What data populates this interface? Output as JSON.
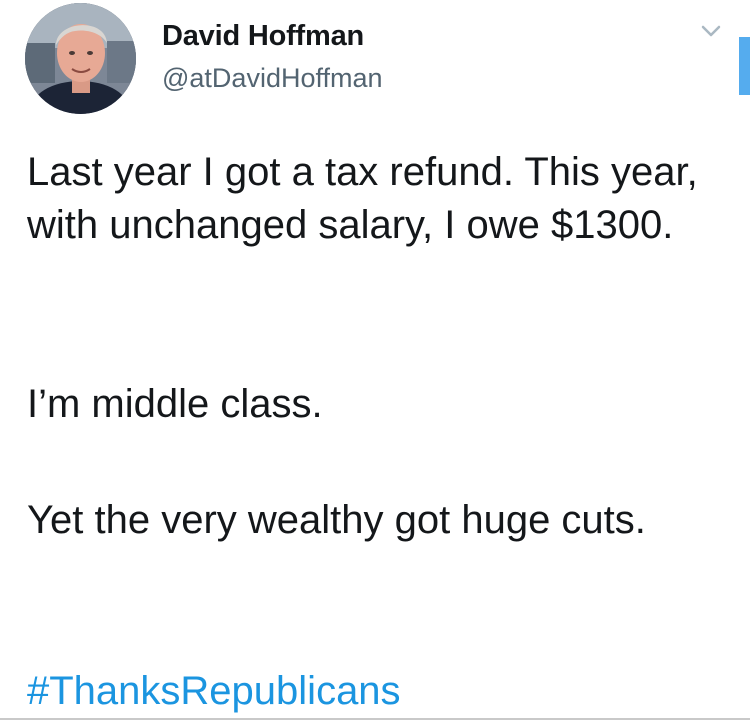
{
  "author": {
    "name": "David Hoffman",
    "handle": "@atDavidHoffman"
  },
  "tweet": {
    "paragraph_1": "Last year I got a tax refund. This year, with unchanged salary, I owe $1300.",
    "paragraph_2": "I’m middle class.",
    "paragraph_3": "Yet the very wealthy got huge cuts.",
    "hashtag": "#ThanksRepublicans"
  },
  "icons": {
    "menu": "chevron-down-icon",
    "avatar": "profile-photo"
  },
  "colors": {
    "text": "#14171a",
    "secondary_text": "#536471",
    "link": "#1b95e0",
    "scrollbar": "#55acee"
  }
}
